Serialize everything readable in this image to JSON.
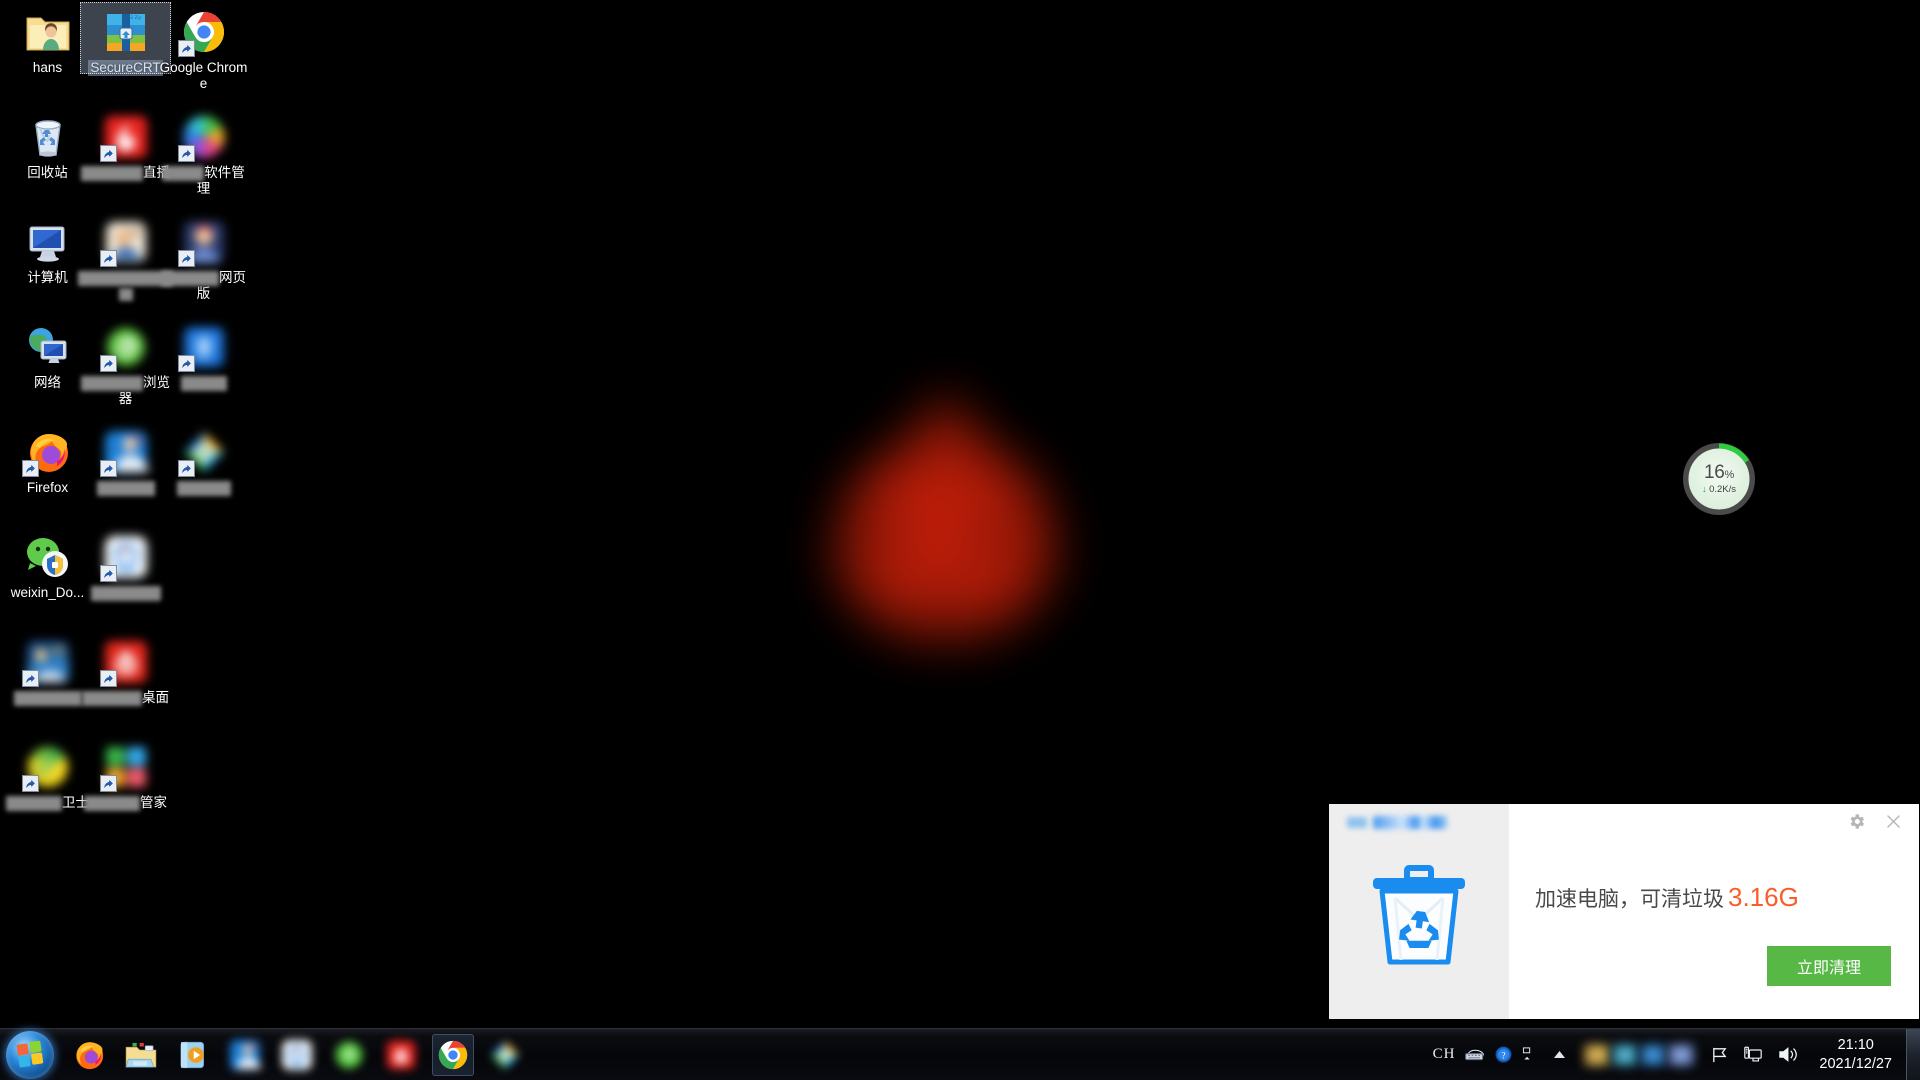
{
  "desktop": {
    "icons": [
      {
        "label": "hans",
        "icon": "folder-user-icon",
        "blurred_label": false,
        "selected": false,
        "shortcut": false,
        "col": 0,
        "row": 0
      },
      {
        "label": "SecureCRT",
        "icon": "securecrt-icon",
        "blurred_label": false,
        "selected": true,
        "shortcut": false,
        "col": 1,
        "row": 0
      },
      {
        "label": "Google Chrome",
        "icon": "google-chrome-icon",
        "blurred_label": false,
        "selected": false,
        "shortcut": true,
        "col": 2,
        "row": 0
      },
      {
        "label": "回收站",
        "icon": "recycle-bin-icon",
        "blurred_label": false,
        "selected": false,
        "shortcut": false,
        "col": 0,
        "row": 1
      },
      {
        "label": "直播",
        "icon": "live-streaming-icon",
        "blurred_label": true,
        "blur_width": 62,
        "selected": false,
        "shortcut": true,
        "col": 1,
        "row": 1
      },
      {
        "label": "软件管理",
        "icon": "software-manager-icon",
        "blurred_label": true,
        "blur_width": 42,
        "selected": false,
        "shortcut": true,
        "col": 2,
        "row": 1
      },
      {
        "label": "计算机",
        "icon": "computer-icon",
        "blurred_label": false,
        "selected": false,
        "shortcut": false,
        "col": 0,
        "row": 2
      },
      {
        "label": "",
        "icon": "photo-app-icon",
        "blurred_label": true,
        "blur_width": 95,
        "blur_width2": 14,
        "selected": false,
        "shortcut": true,
        "col": 1,
        "row": 2
      },
      {
        "label": "网页版",
        "icon": "web-version-icon",
        "blurred_label": true,
        "blur_width": 58,
        "selected": false,
        "shortcut": true,
        "col": 2,
        "row": 2
      },
      {
        "label": "网络",
        "icon": "network-icon",
        "blurred_label": false,
        "selected": false,
        "shortcut": false,
        "col": 0,
        "row": 3
      },
      {
        "label": "浏览器",
        "icon": "green-browser-icon",
        "blurred_label": true,
        "blur_width": 62,
        "selected": false,
        "shortcut": true,
        "col": 1,
        "row": 3
      },
      {
        "label": "",
        "icon": "blue-shield-icon",
        "blurred_label": true,
        "blur_width": 46,
        "selected": false,
        "shortcut": true,
        "col": 2,
        "row": 3
      },
      {
        "label": "Firefox",
        "icon": "firefox-icon",
        "blurred_label": false,
        "selected": false,
        "shortcut": true,
        "col": 0,
        "row": 4
      },
      {
        "label": "",
        "icon": "blue-app-icon",
        "blurred_label": true,
        "blur_width": 58,
        "selected": false,
        "shortcut": true,
        "col": 1,
        "row": 4
      },
      {
        "label": "",
        "icon": "media-player-icon",
        "blurred_label": true,
        "blur_width": 54,
        "selected": false,
        "shortcut": true,
        "col": 2,
        "row": 4
      },
      {
        "label": "weixin_Do...",
        "icon": "wechat-shield-icon",
        "blurred_label": false,
        "selected": false,
        "shortcut": false,
        "col": 0,
        "row": 5
      },
      {
        "label": "",
        "icon": "white-cloud-app-icon",
        "blurred_label": true,
        "blur_width": 70,
        "selected": false,
        "shortcut": true,
        "col": 1,
        "row": 5
      },
      {
        "label": "",
        "icon": "game-app-icon",
        "blurred_label": true,
        "blur_width": 68,
        "selected": false,
        "shortcut": true,
        "col": 0,
        "row": 6
      },
      {
        "label": "桌面",
        "icon": "red-desktop-icon",
        "blurred_label": true,
        "blur_width": 60,
        "selected": false,
        "shortcut": true,
        "col": 1,
        "row": 6
      },
      {
        "label": "卫士",
        "icon": "yellow-guard-icon",
        "blurred_label": true,
        "blur_width": 56,
        "selected": false,
        "shortcut": true,
        "col": 0,
        "row": 7
      },
      {
        "label": "管家",
        "icon": "pc-manager-icon",
        "blurred_label": true,
        "blur_width": 56,
        "selected": false,
        "shortcut": true,
        "col": 1,
        "row": 7
      }
    ]
  },
  "net_widget": {
    "percent_value": "16",
    "percent_unit": "%",
    "speed": "0.2K/s",
    "down_arrow": "↓",
    "ring_percent": 16,
    "ring_color": "#2ecc40",
    "text_color": "#4a4a4a"
  },
  "cleaner_popup": {
    "message_prefix": "加速电脑，可清垃圾",
    "junk_size": "3.16G",
    "junk_size_color": "#fa5d2a",
    "clean_button_label": "立即清理",
    "clean_button_color": "#57b846",
    "settings_icon": "gear-icon",
    "close_icon": "close-icon",
    "bin_icon": "recycle-bin-blue-icon",
    "brand_icon": "brand-logo-blurred"
  },
  "taskbar": {
    "start_button": "windows-start-orb",
    "pinned": [
      {
        "name": "firefox",
        "icon": "firefox-icon",
        "running": false,
        "blurred": false
      },
      {
        "name": "file-explorer",
        "icon": "folder-explorer-icon",
        "running": false,
        "blurred": false
      },
      {
        "name": "media-player",
        "icon": "windows-media-player-icon",
        "running": false,
        "blurred": false
      },
      {
        "name": "app-5",
        "icon": "blue-app-icon",
        "running": false,
        "blurred": true
      },
      {
        "name": "app-6",
        "icon": "white-cloud-app-icon",
        "running": false,
        "blurred": true
      },
      {
        "name": "app-7",
        "icon": "green-app-icon",
        "running": false,
        "blurred": true
      },
      {
        "name": "app-8",
        "icon": "red-app-icon",
        "running": false,
        "blurred": true
      },
      {
        "name": "google-chrome",
        "icon": "google-chrome-icon",
        "running": true,
        "blurred": false
      },
      {
        "name": "app-10",
        "icon": "media-player-colored-icon",
        "running": false,
        "blurred": true
      }
    ],
    "tray": {
      "ime_language": "CH",
      "ime_keyboard_icon": "keyboard-icon",
      "ime_help_icon": "help-icon",
      "ime_more_icon": "ime-options-icon",
      "overflow_icon": "chevron-up-icon",
      "hidden_icons": [
        "tray-icon-a",
        "tray-icon-b",
        "tray-icon-c",
        "tray-icon-d"
      ],
      "action_center_icon": "flag-icon",
      "network_icon": "network-monitor-icon",
      "volume_icon": "volume-icon"
    },
    "clock": {
      "time": "21:10",
      "date": "2021/12/27"
    },
    "show_desktop": "show-desktop-button"
  }
}
